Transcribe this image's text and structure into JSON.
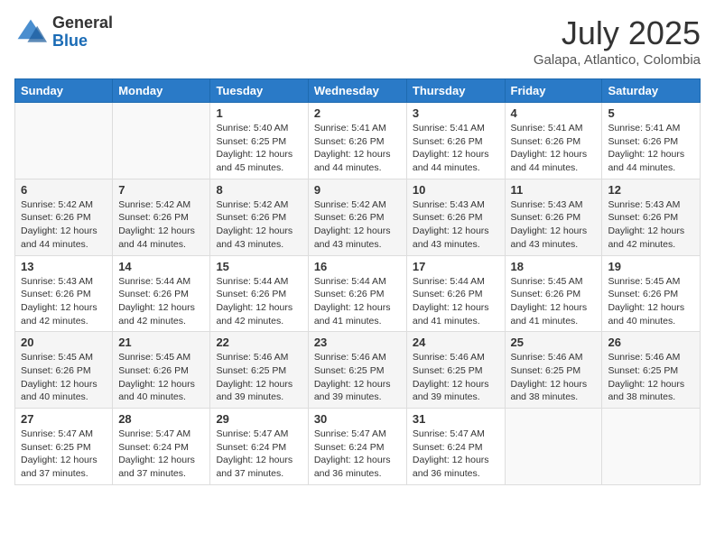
{
  "header": {
    "logo_general": "General",
    "logo_blue": "Blue",
    "month_title": "July 2025",
    "location": "Galapa, Atlantico, Colombia"
  },
  "weekdays": [
    "Sunday",
    "Monday",
    "Tuesday",
    "Wednesday",
    "Thursday",
    "Friday",
    "Saturday"
  ],
  "weeks": [
    [
      {
        "day": "",
        "sunrise": "",
        "sunset": "",
        "daylight": ""
      },
      {
        "day": "",
        "sunrise": "",
        "sunset": "",
        "daylight": ""
      },
      {
        "day": "1",
        "sunrise": "Sunrise: 5:40 AM",
        "sunset": "Sunset: 6:25 PM",
        "daylight": "Daylight: 12 hours and 45 minutes."
      },
      {
        "day": "2",
        "sunrise": "Sunrise: 5:41 AM",
        "sunset": "Sunset: 6:26 PM",
        "daylight": "Daylight: 12 hours and 44 minutes."
      },
      {
        "day": "3",
        "sunrise": "Sunrise: 5:41 AM",
        "sunset": "Sunset: 6:26 PM",
        "daylight": "Daylight: 12 hours and 44 minutes."
      },
      {
        "day": "4",
        "sunrise": "Sunrise: 5:41 AM",
        "sunset": "Sunset: 6:26 PM",
        "daylight": "Daylight: 12 hours and 44 minutes."
      },
      {
        "day": "5",
        "sunrise": "Sunrise: 5:41 AM",
        "sunset": "Sunset: 6:26 PM",
        "daylight": "Daylight: 12 hours and 44 minutes."
      }
    ],
    [
      {
        "day": "6",
        "sunrise": "Sunrise: 5:42 AM",
        "sunset": "Sunset: 6:26 PM",
        "daylight": "Daylight: 12 hours and 44 minutes."
      },
      {
        "day": "7",
        "sunrise": "Sunrise: 5:42 AM",
        "sunset": "Sunset: 6:26 PM",
        "daylight": "Daylight: 12 hours and 44 minutes."
      },
      {
        "day": "8",
        "sunrise": "Sunrise: 5:42 AM",
        "sunset": "Sunset: 6:26 PM",
        "daylight": "Daylight: 12 hours and 43 minutes."
      },
      {
        "day": "9",
        "sunrise": "Sunrise: 5:42 AM",
        "sunset": "Sunset: 6:26 PM",
        "daylight": "Daylight: 12 hours and 43 minutes."
      },
      {
        "day": "10",
        "sunrise": "Sunrise: 5:43 AM",
        "sunset": "Sunset: 6:26 PM",
        "daylight": "Daylight: 12 hours and 43 minutes."
      },
      {
        "day": "11",
        "sunrise": "Sunrise: 5:43 AM",
        "sunset": "Sunset: 6:26 PM",
        "daylight": "Daylight: 12 hours and 43 minutes."
      },
      {
        "day": "12",
        "sunrise": "Sunrise: 5:43 AM",
        "sunset": "Sunset: 6:26 PM",
        "daylight": "Daylight: 12 hours and 42 minutes."
      }
    ],
    [
      {
        "day": "13",
        "sunrise": "Sunrise: 5:43 AM",
        "sunset": "Sunset: 6:26 PM",
        "daylight": "Daylight: 12 hours and 42 minutes."
      },
      {
        "day": "14",
        "sunrise": "Sunrise: 5:44 AM",
        "sunset": "Sunset: 6:26 PM",
        "daylight": "Daylight: 12 hours and 42 minutes."
      },
      {
        "day": "15",
        "sunrise": "Sunrise: 5:44 AM",
        "sunset": "Sunset: 6:26 PM",
        "daylight": "Daylight: 12 hours and 42 minutes."
      },
      {
        "day": "16",
        "sunrise": "Sunrise: 5:44 AM",
        "sunset": "Sunset: 6:26 PM",
        "daylight": "Daylight: 12 hours and 41 minutes."
      },
      {
        "day": "17",
        "sunrise": "Sunrise: 5:44 AM",
        "sunset": "Sunset: 6:26 PM",
        "daylight": "Daylight: 12 hours and 41 minutes."
      },
      {
        "day": "18",
        "sunrise": "Sunrise: 5:45 AM",
        "sunset": "Sunset: 6:26 PM",
        "daylight": "Daylight: 12 hours and 41 minutes."
      },
      {
        "day": "19",
        "sunrise": "Sunrise: 5:45 AM",
        "sunset": "Sunset: 6:26 PM",
        "daylight": "Daylight: 12 hours and 40 minutes."
      }
    ],
    [
      {
        "day": "20",
        "sunrise": "Sunrise: 5:45 AM",
        "sunset": "Sunset: 6:26 PM",
        "daylight": "Daylight: 12 hours and 40 minutes."
      },
      {
        "day": "21",
        "sunrise": "Sunrise: 5:45 AM",
        "sunset": "Sunset: 6:26 PM",
        "daylight": "Daylight: 12 hours and 40 minutes."
      },
      {
        "day": "22",
        "sunrise": "Sunrise: 5:46 AM",
        "sunset": "Sunset: 6:25 PM",
        "daylight": "Daylight: 12 hours and 39 minutes."
      },
      {
        "day": "23",
        "sunrise": "Sunrise: 5:46 AM",
        "sunset": "Sunset: 6:25 PM",
        "daylight": "Daylight: 12 hours and 39 minutes."
      },
      {
        "day": "24",
        "sunrise": "Sunrise: 5:46 AM",
        "sunset": "Sunset: 6:25 PM",
        "daylight": "Daylight: 12 hours and 39 minutes."
      },
      {
        "day": "25",
        "sunrise": "Sunrise: 5:46 AM",
        "sunset": "Sunset: 6:25 PM",
        "daylight": "Daylight: 12 hours and 38 minutes."
      },
      {
        "day": "26",
        "sunrise": "Sunrise: 5:46 AM",
        "sunset": "Sunset: 6:25 PM",
        "daylight": "Daylight: 12 hours and 38 minutes."
      }
    ],
    [
      {
        "day": "27",
        "sunrise": "Sunrise: 5:47 AM",
        "sunset": "Sunset: 6:25 PM",
        "daylight": "Daylight: 12 hours and 37 minutes."
      },
      {
        "day": "28",
        "sunrise": "Sunrise: 5:47 AM",
        "sunset": "Sunset: 6:24 PM",
        "daylight": "Daylight: 12 hours and 37 minutes."
      },
      {
        "day": "29",
        "sunrise": "Sunrise: 5:47 AM",
        "sunset": "Sunset: 6:24 PM",
        "daylight": "Daylight: 12 hours and 37 minutes."
      },
      {
        "day": "30",
        "sunrise": "Sunrise: 5:47 AM",
        "sunset": "Sunset: 6:24 PM",
        "daylight": "Daylight: 12 hours and 36 minutes."
      },
      {
        "day": "31",
        "sunrise": "Sunrise: 5:47 AM",
        "sunset": "Sunset: 6:24 PM",
        "daylight": "Daylight: 12 hours and 36 minutes."
      },
      {
        "day": "",
        "sunrise": "",
        "sunset": "",
        "daylight": ""
      },
      {
        "day": "",
        "sunrise": "",
        "sunset": "",
        "daylight": ""
      }
    ]
  ]
}
